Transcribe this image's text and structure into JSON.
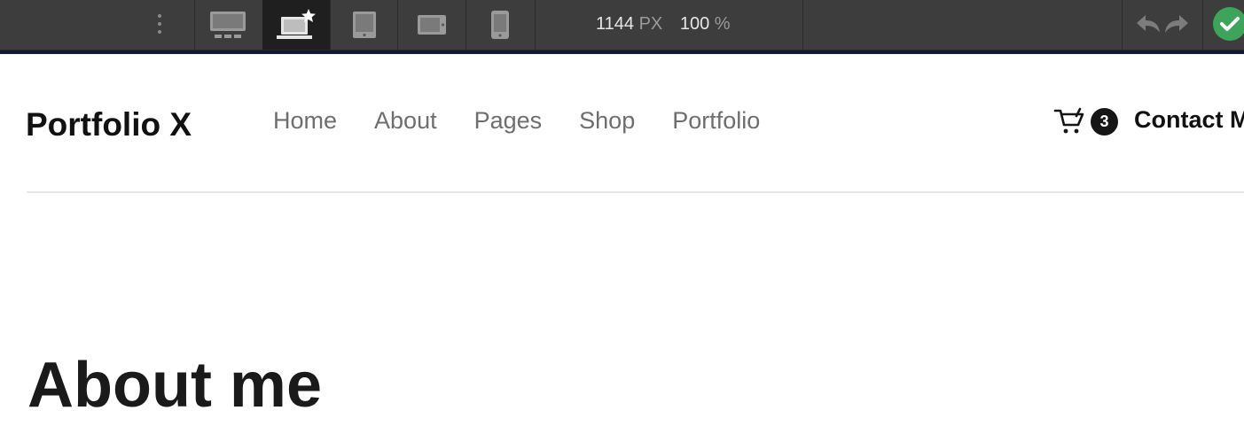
{
  "toolbar": {
    "breakpoints": [
      {
        "name": "desktop",
        "icon": "desktop-icon"
      },
      {
        "name": "laptop",
        "icon": "laptop-star-icon",
        "active": true
      },
      {
        "name": "tablet",
        "icon": "tablet-icon"
      },
      {
        "name": "tablet-landscape",
        "icon": "tablet-landscape-icon"
      },
      {
        "name": "mobile",
        "icon": "mobile-icon"
      }
    ],
    "width_value": "1144",
    "width_unit": "PX",
    "zoom_value": "100",
    "zoom_unit": "%",
    "colors": {
      "background": "#3d3d3d",
      "active": "#1f1f1f",
      "publish": "#3fa45b"
    }
  },
  "site": {
    "logo": "Portfolio X",
    "nav": [
      "Home",
      "About",
      "Pages",
      "Shop",
      "Portfolio"
    ],
    "cart_count": "3",
    "contact_label": "Contact Me"
  },
  "page": {
    "heading": "About me"
  }
}
